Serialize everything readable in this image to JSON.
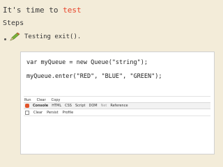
{
  "slide": {
    "title_prefix": "It's time to ",
    "title_highlight": "test",
    "steps_label": "Steps",
    "bullet_text": "Testing exit()."
  },
  "code": {
    "line1": "var myQueue = new Queue(\"string\");",
    "line2": "myQueue.enter(\"RED\", \"BLUE\", \"GREEN\");"
  },
  "firebug": {
    "menubar": [
      "Run",
      "Clear",
      "Copy"
    ],
    "toolbar": [
      "Console",
      "HTML",
      "CSS",
      "Script",
      "DOM",
      "Net",
      "Reference"
    ],
    "active_tab": "Console",
    "dim_tab": "Net",
    "subbar": [
      "Clear",
      "Persist",
      "Profile"
    ]
  },
  "colors": {
    "background": "#f3ecd9",
    "highlight": "#e8432a"
  }
}
